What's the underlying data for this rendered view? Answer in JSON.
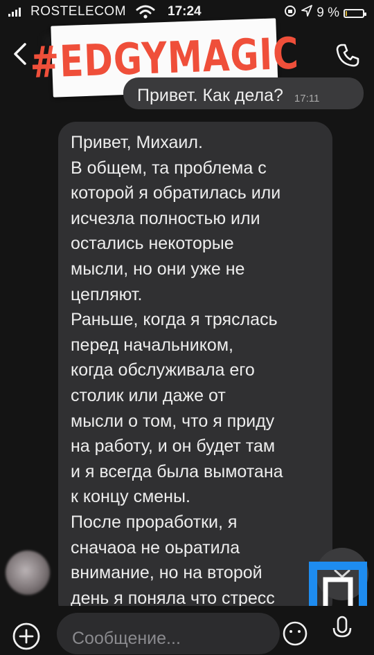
{
  "status_bar": {
    "carrier": "ROSTELECOM",
    "time": "17:24",
    "battery_text": "9 %",
    "battery_level": 0.09
  },
  "sticker": {
    "text": "#EDGYMAGIC",
    "color": "#ef4f3a"
  },
  "outgoing_message": {
    "text": "Привет. Как дела?",
    "time": "17:11"
  },
  "incoming_message": {
    "lines": [
      "Привет, Михаил.",
      "В общем, та проблема с",
      "которой я обратилась или",
      "исчезла полностью или",
      "остались некоторые",
      "мысли, но они уже не",
      "цепляют.",
      "Раньше, когда я тряслась",
      "перед начальником,",
      "когда обслуживала его",
      "столик или даже от",
      "мысли о том, что я приду",
      "на работу, и он будет там",
      "и я всегда была вымотана",
      "к концу смены.",
      "После проработки, я",
      "сначаоа не оьратила",
      "внимание, но на второй",
      "день я поняла что стресс"
    ]
  },
  "composer": {
    "placeholder": "Сообщение..."
  },
  "icons": {
    "back": "chevron-left-icon",
    "call": "phone-icon",
    "add": "plus-circle-icon",
    "emoji": "emoji-icon",
    "mic": "microphone-icon",
    "scroll": "chevron-down-icon"
  },
  "colors": {
    "background": "#141414",
    "bubble": "#303032",
    "logo": "#1e8cf0"
  }
}
